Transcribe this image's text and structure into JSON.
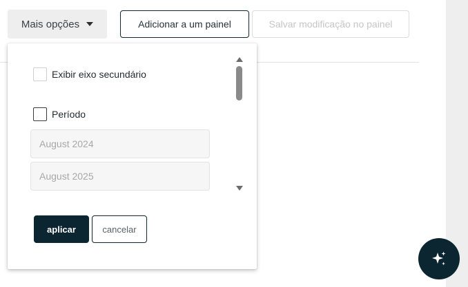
{
  "toolbar": {
    "more_options_label": "Mais opções",
    "add_to_panel_label": "Adicionar a um painel",
    "save_changes_label": "Salvar modificação no painel"
  },
  "dropdown": {
    "secondary_axis_label": "Exibir eixo secundário",
    "period_label": "Período",
    "period_start_placeholder": "August 2024",
    "period_end_placeholder": "August 2025",
    "apply_label": "aplicar",
    "cancel_label": "cancelar"
  },
  "icons": {
    "more_options_caret": "caret-down-icon",
    "scroll_up": "scroll-up-arrow-icon",
    "scroll_down": "scroll-down-arrow-icon",
    "assistant": "sparkle-icon"
  },
  "colors": {
    "primary": "#0b2531",
    "neutral_button_bg": "#eeeeee",
    "disabled_text": "#c6c6c6"
  }
}
